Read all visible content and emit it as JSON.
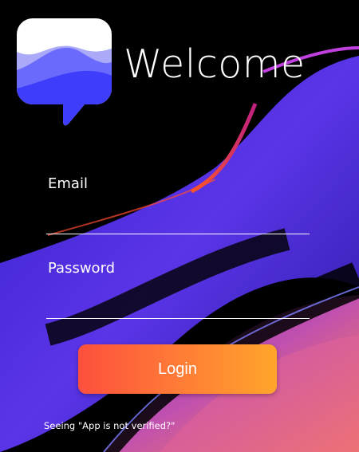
{
  "header": {
    "title": "Welcome",
    "logo_icon": "chat-bubble-waves-icon"
  },
  "form": {
    "email_label": "Email",
    "email_value": "",
    "email_placeholder": "",
    "password_label": "Password",
    "password_value": "",
    "password_placeholder": "",
    "login_label": "Login"
  },
  "footer": {
    "unverified_link": "Seeing \"App is not verified?\""
  },
  "colors": {
    "accent_start": "#fd4f3d",
    "accent_end": "#ffa52b",
    "logo_blue": "#3d3dfb"
  }
}
